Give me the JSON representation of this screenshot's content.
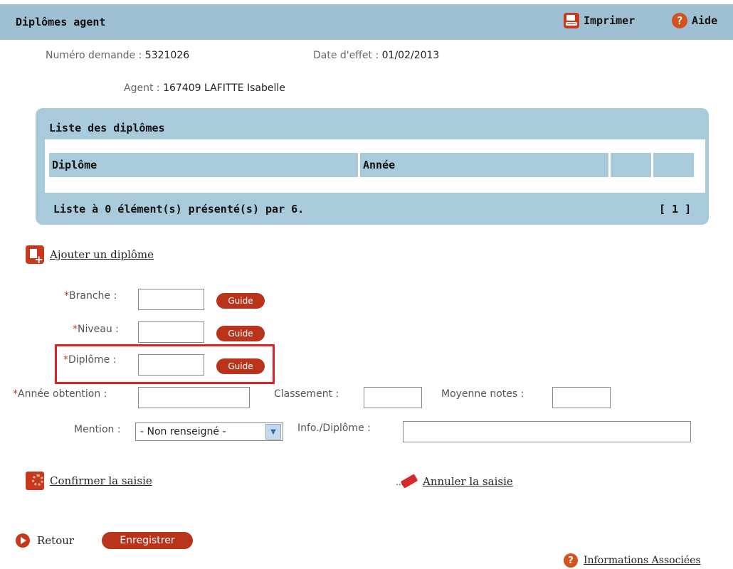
{
  "header": {
    "title": "Diplômes agent",
    "print_label": "Imprimer",
    "help_label": "Aide"
  },
  "info": {
    "numero_label": "Numéro demande :",
    "numero_value": "5321026",
    "date_label": "Date d'effet :",
    "date_value": "01/02/2013",
    "agent_label": "Agent :",
    "agent_value": "167409 LAFITTE Isabelle"
  },
  "list": {
    "title": "Liste des diplômes",
    "columns": [
      "Diplôme",
      "Année",
      "",
      ""
    ],
    "footer": "Liste à 0 élément(s) présenté(s) par 6.",
    "pagination": "[ 1 ]"
  },
  "add_link": "Ajouter un diplôme",
  "form": {
    "required_mark": "*",
    "branche_label": "Branche :",
    "niveau_label": "Niveau :",
    "diplome_label": "Diplôme :",
    "annee_label": "Année obtention :",
    "classement_label": "Classement :",
    "moyenne_label": "Moyenne notes :",
    "mention_label": "Mention :",
    "mention_value": "- Non renseigné -",
    "info_label": "Info./Diplôme :",
    "guide_label": "Guide"
  },
  "actions": {
    "confirm": "Confirmer la saisie",
    "cancel": "Annuler la saisie",
    "back": "Retour",
    "save": "Enregistrer",
    "infos": "Informations Associées"
  },
  "icons": {
    "print": "print-icon",
    "help": "help-icon",
    "add": "add-document-icon",
    "confirm": "confirm-icon",
    "eraser": "eraser-icon",
    "back": "play-arrow-icon"
  },
  "colors": {
    "header_bg": "#9fc0d2",
    "accent": "#c8391b",
    "highlight": "#e0202a"
  }
}
